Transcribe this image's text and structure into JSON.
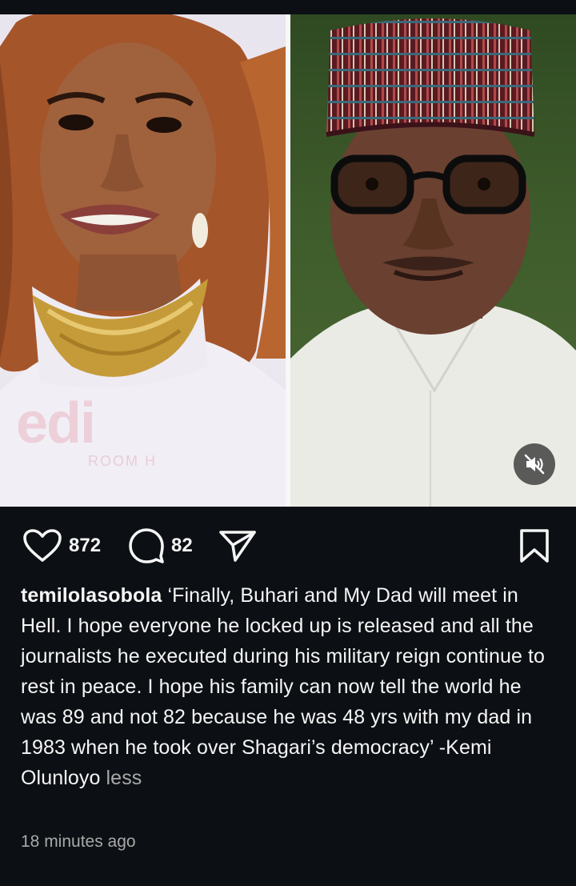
{
  "post": {
    "media": {
      "left_image_alt": "Woman with curly auburn hair wearing gold statement necklace",
      "right_image_alt": "Man wearing patterned cap and black glasses",
      "watermark_text": "edi",
      "watermark_subtext": "ROOM H",
      "mute_icon": "speaker-muted-icon"
    },
    "actions": {
      "like_count": "872",
      "comment_count": "82",
      "like_icon": "heart-icon",
      "comment_icon": "comment-bubble-icon",
      "share_icon": "send-icon",
      "save_icon": "bookmark-icon"
    },
    "caption": {
      "username": "temilolasobola",
      "text": "‘Finally, Buhari and My Dad will meet in Hell. I hope everyone he locked up is released and all the journalists he executed during his military reign continue to rest in peace. I hope his family can now tell the world he was 89 and not 82 because he was 48 yrs with my dad in 1983 when he took over Shagari’s democracy’ -Kemi Olunloyo",
      "toggle_label": "less"
    },
    "timestamp": "18 minutes ago"
  },
  "colors": {
    "background": "#0c1014",
    "text_primary": "#f5f5f5",
    "text_secondary": "#a8a8a8"
  }
}
